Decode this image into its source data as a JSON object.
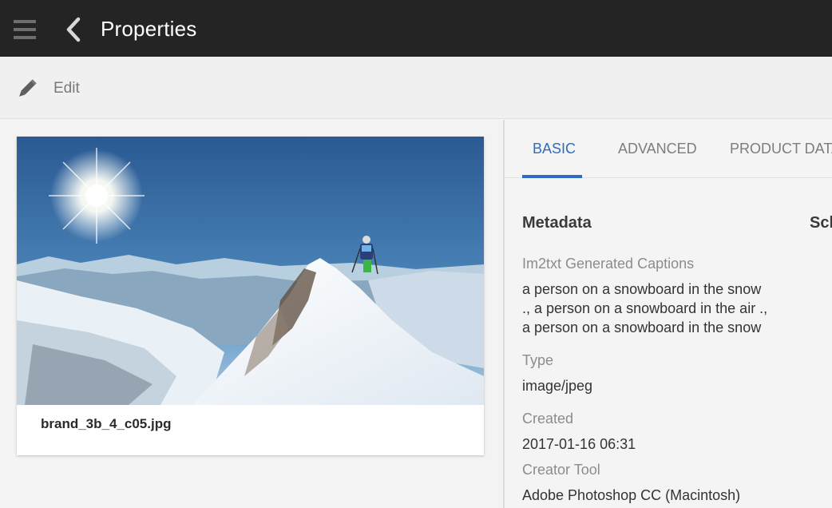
{
  "topbar": {
    "title": "Properties",
    "menu_icon": "hamburger-menu-icon",
    "back_icon": "chevron-left-icon"
  },
  "actionbar": {
    "edit_label": "Edit",
    "edit_icon": "pencil-icon"
  },
  "asset": {
    "filename": "brand_3b_4_c05.jpg"
  },
  "tabs": [
    {
      "label": "BASIC",
      "active": true
    },
    {
      "label": "ADVANCED",
      "active": false
    },
    {
      "label": "PRODUCT DATA",
      "active": false
    }
  ],
  "metadata": {
    "section_title": "Metadata",
    "second_section_title": "Sch",
    "fields": [
      {
        "label": "Im2txt Generated Captions",
        "value_lines": [
          "a person on a snowboard in the snow",
          "., a person on a snowboard in the air .,",
          "a person on a snowboard in the snow"
        ]
      },
      {
        "label": "Type",
        "value": "image/jpeg"
      },
      {
        "label": "Created",
        "value": "2017-01-16 06:31"
      },
      {
        "label": "Creator Tool",
        "value": "Adobe Photoshop CC (Macintosh)"
      }
    ]
  },
  "colors": {
    "topbar_bg": "#242424",
    "accent": "#2d6cc2",
    "panel_bg": "#f3f3f3"
  }
}
